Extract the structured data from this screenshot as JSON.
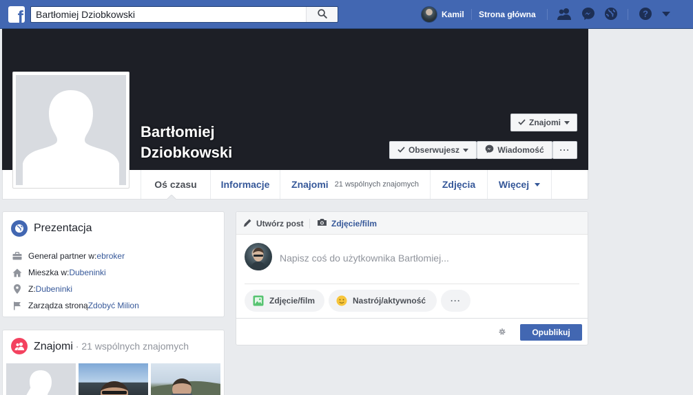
{
  "topbar": {
    "logo": "f",
    "search_value": "Bartłomiej Dziobkowski",
    "user_name": "Kamil",
    "home_label": "Strona główna",
    "icons": [
      "search-icon",
      "friend-requests-icon",
      "messenger-icon",
      "notifications-globe-icon",
      "help-icon",
      "account-menu-icon"
    ]
  },
  "profile": {
    "name_line1": "Bartłomiej",
    "name_line2": "Dziobkowski",
    "friends_button": "Znajomi",
    "following_button": "Obserwujesz",
    "message_button": "Wiadomość",
    "more_button": "···"
  },
  "tabs": [
    {
      "label": "Oś czasu"
    },
    {
      "label": "Informacje"
    },
    {
      "label": "Znajomi",
      "sub": "21 wspólnych znajomych"
    },
    {
      "label": "Zdjęcia"
    },
    {
      "label": "Więcej"
    }
  ],
  "intro": {
    "title": "Prezentacja",
    "rows": [
      {
        "prefix": "General partner w: ",
        "link": "ebroker"
      },
      {
        "prefix": "Mieszka w: ",
        "link": "Dubeninki"
      },
      {
        "prefix": "Z: ",
        "link": "Dubeninki"
      },
      {
        "prefix": "Zarządza stroną ",
        "link": "Zdobyć Milion"
      }
    ]
  },
  "friends_card": {
    "title": "Znajomi",
    "subtitle": " · 21 wspólnych znajomych"
  },
  "composer": {
    "create_post": "Utwórz post",
    "photo_video_tab": "Zdjęcie/film",
    "placeholder": "Napisz coś do użytkownika Bartłomiej...",
    "photo_video_pill": "Zdjęcie/film",
    "feeling_pill": "Nastrój/aktywność",
    "more_pill": "···",
    "publish": "Opublikuj"
  },
  "colors": {
    "brand_blue": "#4267b2",
    "link_blue": "#365899",
    "cover": "#1d1f26",
    "background": "#e9ebee"
  }
}
